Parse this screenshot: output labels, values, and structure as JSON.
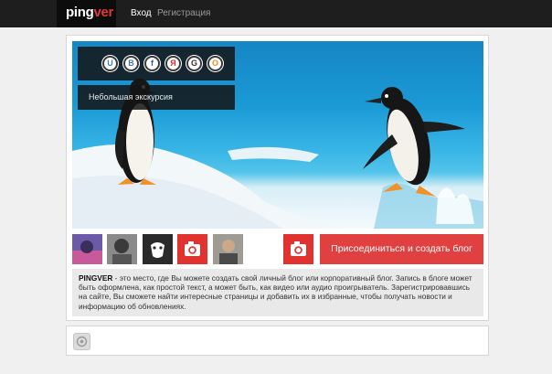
{
  "navbar": {
    "logo_text": "pingver",
    "login_label": "Вход",
    "register_label": "Регистрация"
  },
  "hero": {
    "social_icons": [
      "u-icon",
      "vk-icon",
      "facebook-icon",
      "yandex-icon",
      "google-icon",
      "odnoklassniki-icon"
    ],
    "social_letters": [
      "U",
      "B",
      "f",
      "Я",
      "G",
      "O"
    ],
    "caption": "Небольшая экскурсия"
  },
  "thumbs": [
    "user-avatar",
    "user-avatar",
    "user-avatar",
    "camera-icon",
    "user-avatar",
    "camera-icon"
  ],
  "join_button_label": "Присоединиться и создать блог",
  "description": {
    "brand": "PINGVER",
    "text": " - это место, где Вы можете создать свой личный блог или корпоративный блог. Запись в блоге может быть оформлена, как простой текст, а может быть, как видео или аудио проигрыватель. Зарегистрировавшись на сайте, Вы сможете найти интересные страницы и добавить их в избранные, чтобы получать новости и информацию об обновлениях."
  },
  "colors": {
    "accent": "#e04040",
    "navbar": "#1e1e1e"
  }
}
